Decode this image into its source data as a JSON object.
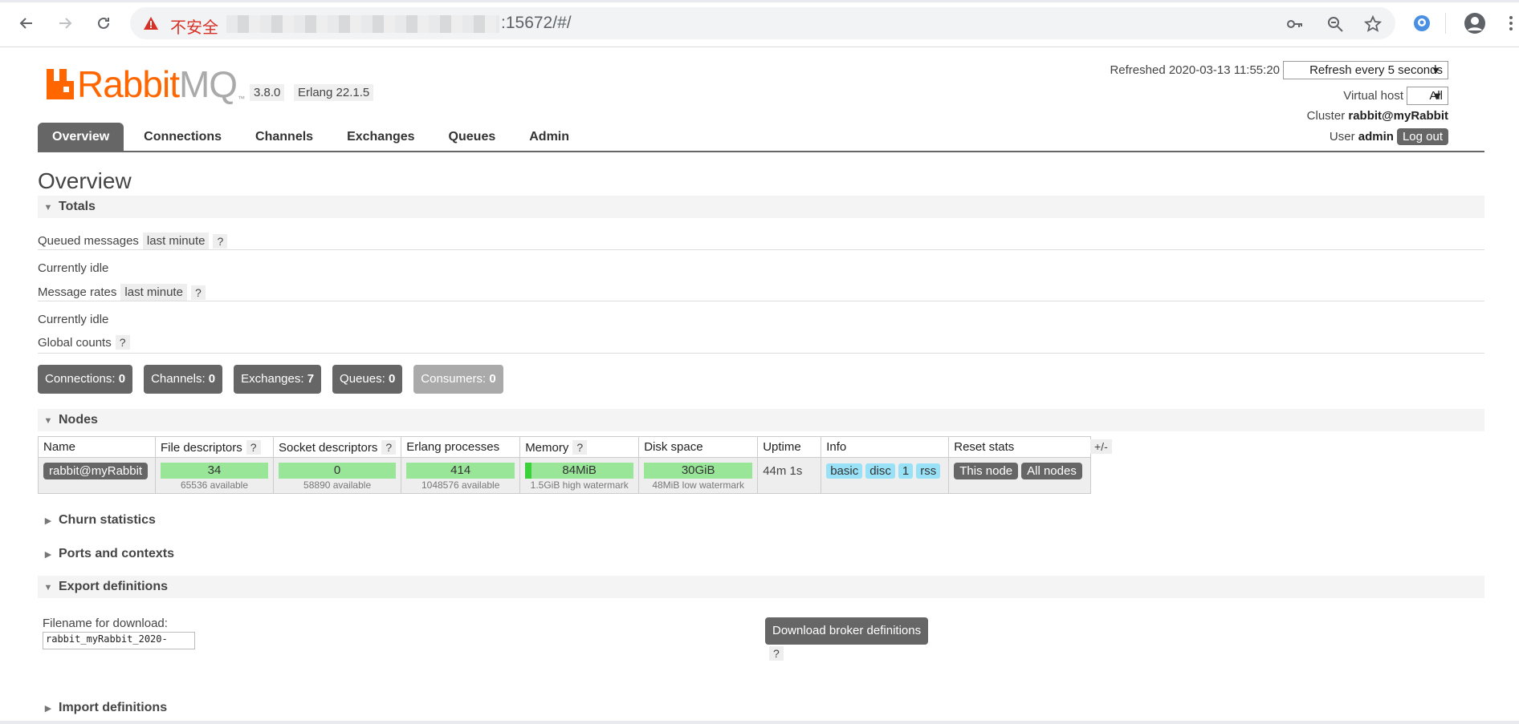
{
  "browser": {
    "insecure_label": "不安全",
    "url_suffix": ":15672/#/"
  },
  "brand": {
    "logo_main": "Rabbit",
    "logo_mq": "MQ",
    "logo_tm": "™",
    "version": "3.8.0",
    "erlang": "Erlang 22.1.5"
  },
  "header": {
    "refreshed_label": "Refreshed 2020-03-13 11:55:20",
    "refresh_select": "Refresh every 5 seconds",
    "vhost_label": "Virtual host",
    "vhost_select": "All",
    "cluster_label": "Cluster",
    "cluster_value": "rabbit@myRabbit",
    "user_label": "User",
    "user_value": "admin",
    "logout": "Log out"
  },
  "tabs": [
    {
      "label": "Overview",
      "active": true
    },
    {
      "label": "Connections"
    },
    {
      "label": "Channels"
    },
    {
      "label": "Exchanges"
    },
    {
      "label": "Queues"
    },
    {
      "label": "Admin"
    }
  ],
  "page_title": "Overview",
  "totals": {
    "title": "Totals",
    "queued_label": "Queued messages",
    "queued_range": "last minute",
    "help": "?",
    "idle1": "Currently idle",
    "rates_label": "Message rates",
    "rates_range": "last minute",
    "idle2": "Currently idle",
    "global_label": "Global counts"
  },
  "counts": [
    {
      "label": "Connections:",
      "value": "0"
    },
    {
      "label": "Channels:",
      "value": "0"
    },
    {
      "label": "Exchanges:",
      "value": "7"
    },
    {
      "label": "Queues:",
      "value": "0"
    },
    {
      "label": "Consumers:",
      "value": "0"
    }
  ],
  "nodes": {
    "title": "Nodes",
    "headers": {
      "name": "Name",
      "fd": "File descriptors",
      "sd": "Socket descriptors",
      "ep": "Erlang processes",
      "mem": "Memory",
      "disk": "Disk space",
      "uptime": "Uptime",
      "info": "Info",
      "reset": "Reset stats"
    },
    "row": {
      "name": "rabbit@myRabbit",
      "fd_value": "34",
      "fd_sub": "65536 available",
      "sd_value": "0",
      "sd_sub": "58890 available",
      "ep_value": "414",
      "ep_sub": "1048576 available",
      "mem_value": "84MiB",
      "mem_sub": "1.5GiB high watermark",
      "mem_fill": 0.055,
      "disk_value": "30GiB",
      "disk_sub": "48MiB low watermark",
      "uptime": "44m 1s",
      "info_tags": [
        "basic",
        "disc",
        "1",
        "rss"
      ],
      "this_node": "This node",
      "all_nodes": "All nodes"
    },
    "plusminus": "+/-"
  },
  "sections": {
    "churn": "Churn statistics",
    "ports": "Ports and contexts",
    "export": "Export definitions",
    "import": "Import definitions"
  },
  "export": {
    "filename_label": "Filename for download:",
    "filename_value": "rabbit_myRabbit_2020-",
    "download_button": "Download broker definitions",
    "help": "?"
  },
  "colors": {
    "brand_orange": "#ff6600",
    "bar_green": "#99e699",
    "info_blue": "#99e1f7",
    "button_grey": "#666666"
  }
}
